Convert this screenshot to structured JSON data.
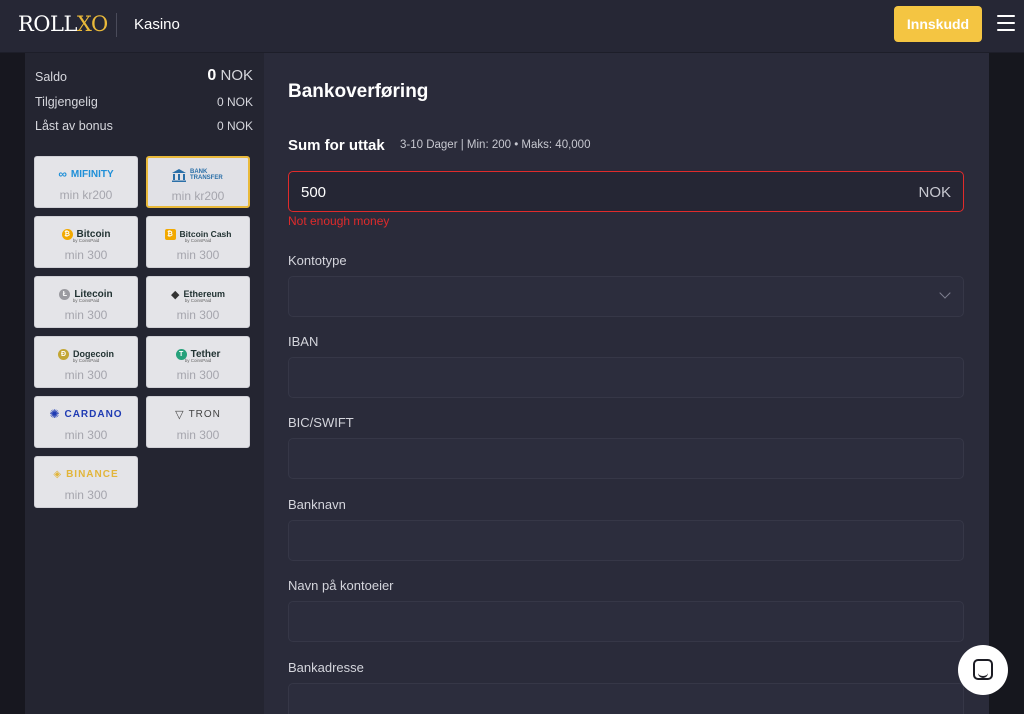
{
  "header": {
    "logo_text_1": "ROLL",
    "logo_text_2": "XO",
    "section": "Kasino",
    "deposit_label": "Innskudd"
  },
  "balance": {
    "rows": [
      {
        "label": "Saldo",
        "value_num": "0",
        "value_cur": "NOK"
      },
      {
        "label": "Tilgjengelig",
        "value": "0 NOK"
      },
      {
        "label": "Låst av bonus",
        "value": "0 NOK"
      }
    ]
  },
  "payment_methods": [
    {
      "name": "MIFINITY",
      "min": "min kr200",
      "color": "#1e8fd8"
    },
    {
      "name": "BANK TRANSFER",
      "min": "min kr200",
      "color": "#2a6fa8",
      "selected": true
    },
    {
      "name": "Bitcoin",
      "sub": "by CoinsPaid",
      "min": "min 300",
      "color": "#f2a900"
    },
    {
      "name": "Bitcoin Cash",
      "sub": "by CoinsPaid",
      "min": "min 300",
      "color": "#f2a900"
    },
    {
      "name": "Litecoin",
      "sub": "by CoinsPaid",
      "min": "min 300",
      "color": "#9a9aa0"
    },
    {
      "name": "Ethereum",
      "sub": "by CoinsPaid",
      "min": "min 300",
      "color": "#333333"
    },
    {
      "name": "Dogecoin",
      "sub": "by CoinsPaid",
      "min": "min 300",
      "color": "#c3a634"
    },
    {
      "name": "Tether",
      "sub": "by CoinsPaid",
      "min": "min 300",
      "color": "#26a17b"
    },
    {
      "name": "CARDANO",
      "min": "min 300",
      "color": "#1f3bb3"
    },
    {
      "name": "TRON",
      "min": "min 300",
      "color": "#444444"
    },
    {
      "name": "BINANCE",
      "min": "min 300",
      "color": "#e2b53a"
    }
  ],
  "form": {
    "title": "Bankoverføring",
    "sum_label": "Sum for uttak",
    "sum_info": "3-10 Dager | Min: 200 • Maks: 40,000",
    "amount_value": "500",
    "amount_currency": "NOK",
    "error": "Not enough money",
    "fields": [
      {
        "label": "Kontotype",
        "type": "select",
        "value": ""
      },
      {
        "label": "IBAN",
        "type": "text",
        "value": ""
      },
      {
        "label": "BIC/SWIFT",
        "type": "text",
        "value": ""
      },
      {
        "label": "Banknavn",
        "type": "text",
        "value": ""
      },
      {
        "label": "Navn på kontoeier",
        "type": "text",
        "value": ""
      },
      {
        "label": "Bankadresse",
        "type": "text",
        "value": ""
      }
    ]
  },
  "icons": [
    "hamburger-menu-icon",
    "chat-icon",
    "chevron-down-icon",
    "bank-icon"
  ]
}
